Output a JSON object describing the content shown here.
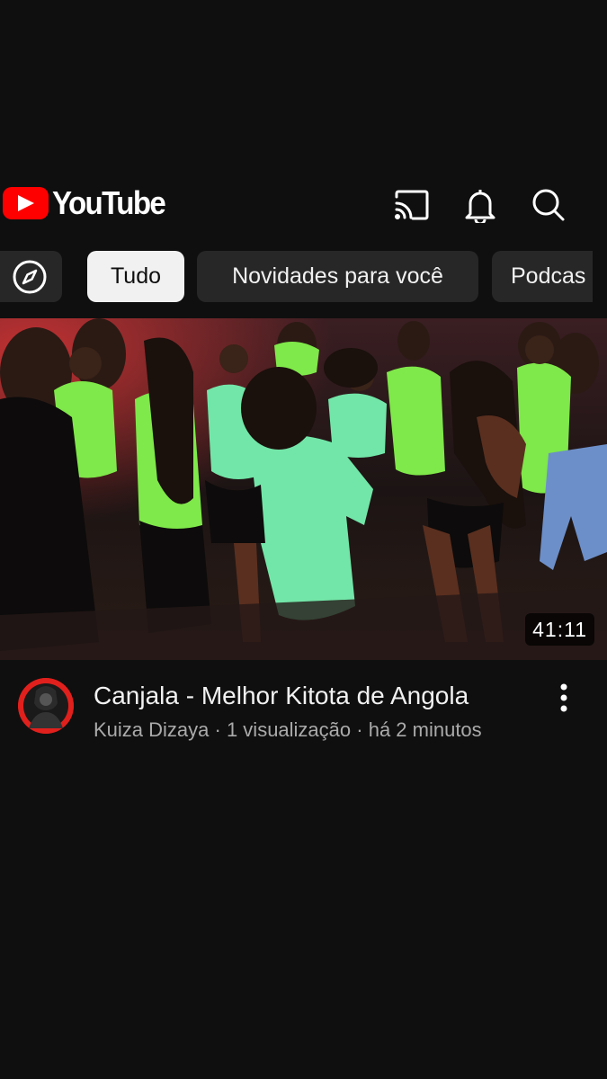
{
  "header": {
    "logo_text": "YouTube",
    "icons": [
      "cast-icon",
      "bell-icon",
      "search-icon"
    ]
  },
  "chips": {
    "explore_icon": "compass-icon",
    "items": [
      {
        "label": "Tudo",
        "selected": true
      },
      {
        "label": "Novidades para você",
        "selected": false
      },
      {
        "label": "Podcas",
        "selected": false
      }
    ]
  },
  "video": {
    "duration": "41:11",
    "title": "Canjala - Melhor Kitota de Angola",
    "channel": "Kuiza Dizaya",
    "views": "1 visualização",
    "age": "há 2 minutos",
    "separator": " · "
  },
  "colors": {
    "background": "#0f0f0f",
    "brand_red": "#ff0000",
    "chip_bg": "#272727",
    "chip_active_bg": "#f1f1f1",
    "secondary_text": "#aaaaaa"
  }
}
